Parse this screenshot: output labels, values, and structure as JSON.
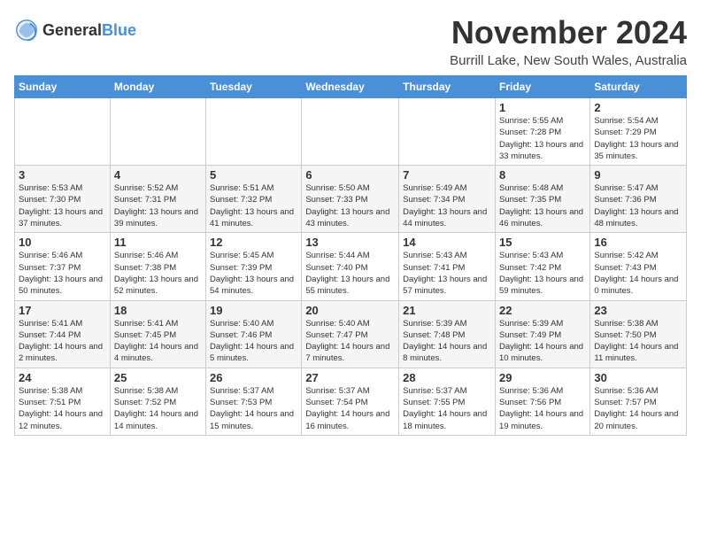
{
  "logo": {
    "general": "General",
    "blue": "Blue"
  },
  "title": "November 2024",
  "location": "Burrill Lake, New South Wales, Australia",
  "days_of_week": [
    "Sunday",
    "Monday",
    "Tuesday",
    "Wednesday",
    "Thursday",
    "Friday",
    "Saturday"
  ],
  "weeks": [
    [
      {
        "day": "",
        "info": ""
      },
      {
        "day": "",
        "info": ""
      },
      {
        "day": "",
        "info": ""
      },
      {
        "day": "",
        "info": ""
      },
      {
        "day": "",
        "info": ""
      },
      {
        "day": "1",
        "info": "Sunrise: 5:55 AM\nSunset: 7:28 PM\nDaylight: 13 hours and 33 minutes."
      },
      {
        "day": "2",
        "info": "Sunrise: 5:54 AM\nSunset: 7:29 PM\nDaylight: 13 hours and 35 minutes."
      }
    ],
    [
      {
        "day": "3",
        "info": "Sunrise: 5:53 AM\nSunset: 7:30 PM\nDaylight: 13 hours and 37 minutes."
      },
      {
        "day": "4",
        "info": "Sunrise: 5:52 AM\nSunset: 7:31 PM\nDaylight: 13 hours and 39 minutes."
      },
      {
        "day": "5",
        "info": "Sunrise: 5:51 AM\nSunset: 7:32 PM\nDaylight: 13 hours and 41 minutes."
      },
      {
        "day": "6",
        "info": "Sunrise: 5:50 AM\nSunset: 7:33 PM\nDaylight: 13 hours and 43 minutes."
      },
      {
        "day": "7",
        "info": "Sunrise: 5:49 AM\nSunset: 7:34 PM\nDaylight: 13 hours and 44 minutes."
      },
      {
        "day": "8",
        "info": "Sunrise: 5:48 AM\nSunset: 7:35 PM\nDaylight: 13 hours and 46 minutes."
      },
      {
        "day": "9",
        "info": "Sunrise: 5:47 AM\nSunset: 7:36 PM\nDaylight: 13 hours and 48 minutes."
      }
    ],
    [
      {
        "day": "10",
        "info": "Sunrise: 5:46 AM\nSunset: 7:37 PM\nDaylight: 13 hours and 50 minutes."
      },
      {
        "day": "11",
        "info": "Sunrise: 5:46 AM\nSunset: 7:38 PM\nDaylight: 13 hours and 52 minutes."
      },
      {
        "day": "12",
        "info": "Sunrise: 5:45 AM\nSunset: 7:39 PM\nDaylight: 13 hours and 54 minutes."
      },
      {
        "day": "13",
        "info": "Sunrise: 5:44 AM\nSunset: 7:40 PM\nDaylight: 13 hours and 55 minutes."
      },
      {
        "day": "14",
        "info": "Sunrise: 5:43 AM\nSunset: 7:41 PM\nDaylight: 13 hours and 57 minutes."
      },
      {
        "day": "15",
        "info": "Sunrise: 5:43 AM\nSunset: 7:42 PM\nDaylight: 13 hours and 59 minutes."
      },
      {
        "day": "16",
        "info": "Sunrise: 5:42 AM\nSunset: 7:43 PM\nDaylight: 14 hours and 0 minutes."
      }
    ],
    [
      {
        "day": "17",
        "info": "Sunrise: 5:41 AM\nSunset: 7:44 PM\nDaylight: 14 hours and 2 minutes."
      },
      {
        "day": "18",
        "info": "Sunrise: 5:41 AM\nSunset: 7:45 PM\nDaylight: 14 hours and 4 minutes."
      },
      {
        "day": "19",
        "info": "Sunrise: 5:40 AM\nSunset: 7:46 PM\nDaylight: 14 hours and 5 minutes."
      },
      {
        "day": "20",
        "info": "Sunrise: 5:40 AM\nSunset: 7:47 PM\nDaylight: 14 hours and 7 minutes."
      },
      {
        "day": "21",
        "info": "Sunrise: 5:39 AM\nSunset: 7:48 PM\nDaylight: 14 hours and 8 minutes."
      },
      {
        "day": "22",
        "info": "Sunrise: 5:39 AM\nSunset: 7:49 PM\nDaylight: 14 hours and 10 minutes."
      },
      {
        "day": "23",
        "info": "Sunrise: 5:38 AM\nSunset: 7:50 PM\nDaylight: 14 hours and 11 minutes."
      }
    ],
    [
      {
        "day": "24",
        "info": "Sunrise: 5:38 AM\nSunset: 7:51 PM\nDaylight: 14 hours and 12 minutes."
      },
      {
        "day": "25",
        "info": "Sunrise: 5:38 AM\nSunset: 7:52 PM\nDaylight: 14 hours and 14 minutes."
      },
      {
        "day": "26",
        "info": "Sunrise: 5:37 AM\nSunset: 7:53 PM\nDaylight: 14 hours and 15 minutes."
      },
      {
        "day": "27",
        "info": "Sunrise: 5:37 AM\nSunset: 7:54 PM\nDaylight: 14 hours and 16 minutes."
      },
      {
        "day": "28",
        "info": "Sunrise: 5:37 AM\nSunset: 7:55 PM\nDaylight: 14 hours and 18 minutes."
      },
      {
        "day": "29",
        "info": "Sunrise: 5:36 AM\nSunset: 7:56 PM\nDaylight: 14 hours and 19 minutes."
      },
      {
        "day": "30",
        "info": "Sunrise: 5:36 AM\nSunset: 7:57 PM\nDaylight: 14 hours and 20 minutes."
      }
    ]
  ]
}
